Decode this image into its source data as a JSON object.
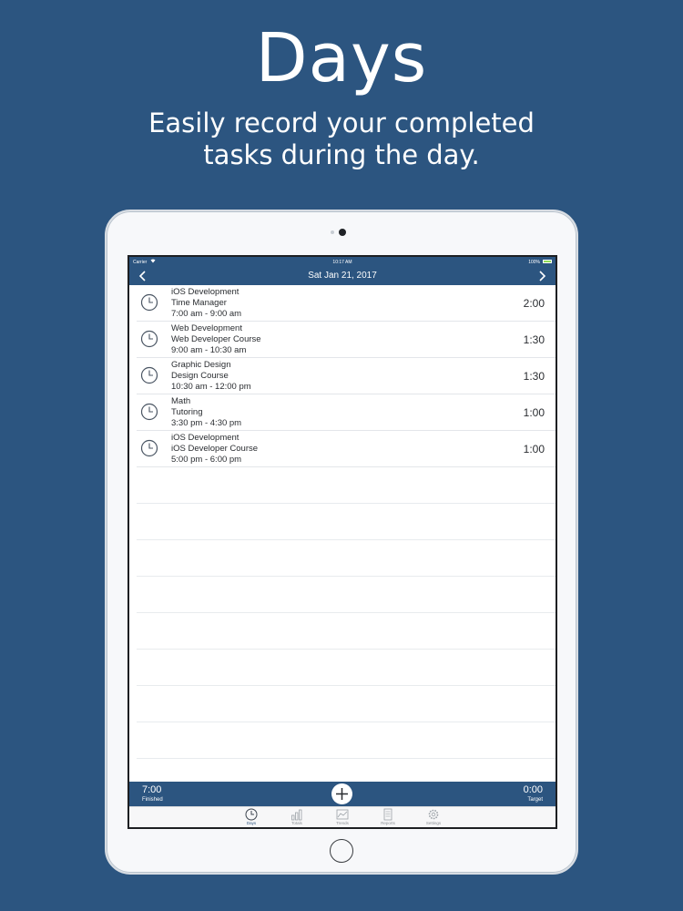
{
  "promo": {
    "title": "Days",
    "subtitle_line1": "Easily record your completed",
    "subtitle_line2": "tasks during the day."
  },
  "status_bar": {
    "carrier": "Carrier",
    "time": "10:17 AM",
    "battery": "100%"
  },
  "nav_bar": {
    "date": "Sat Jan 21, 2017",
    "prev_icon": "chevron-left-icon",
    "next_icon": "chevron-right-icon"
  },
  "tasks": [
    {
      "category": "iOS Development",
      "project": "Time Manager",
      "time_range": "7:00 am - 9:00 am",
      "duration": "2:00"
    },
    {
      "category": "Web Development",
      "project": "Web Developer Course",
      "time_range": "9:00 am - 10:30 am",
      "duration": "1:30"
    },
    {
      "category": "Graphic Design",
      "project": "Design Course",
      "time_range": "10:30 am - 12:00 pm",
      "duration": "1:30"
    },
    {
      "category": "Math",
      "project": "Tutoring",
      "time_range": "3:30 pm - 4:30 pm",
      "duration": "1:00"
    },
    {
      "category": "iOS Development",
      "project": "iOS Developer Course",
      "time_range": "5:00 pm - 6:00 pm",
      "duration": "1:00"
    }
  ],
  "summary": {
    "finished_value": "7:00",
    "finished_label": "Finished",
    "target_value": "0:00",
    "target_label": "Target"
  },
  "tabs": [
    {
      "label": "Days",
      "icon": "clock-icon",
      "active": true
    },
    {
      "label": "Totals",
      "icon": "bar-chart-icon",
      "active": false
    },
    {
      "label": "Trends",
      "icon": "line-chart-icon",
      "active": false
    },
    {
      "label": "Reports",
      "icon": "document-icon",
      "active": false
    },
    {
      "label": "Settings",
      "icon": "gear-icon",
      "active": false
    }
  ],
  "colors": {
    "background": "#2c5580",
    "bar": "#2c5580",
    "text": "#2a2d31"
  }
}
